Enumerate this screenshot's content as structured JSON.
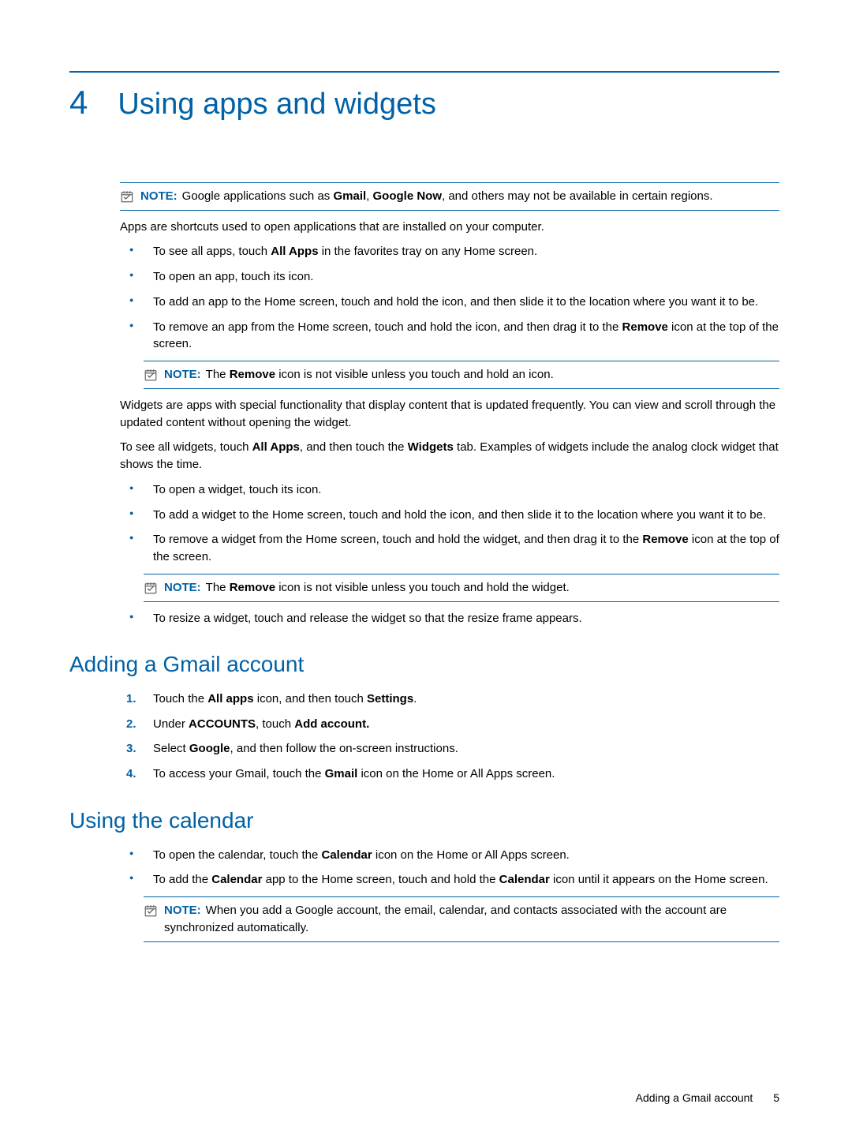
{
  "chapter": {
    "number": "4",
    "title": "Using apps and widgets"
  },
  "notes": {
    "label": "NOTE:",
    "main_region": "Google applications such as <b>Gmail</b>, <b>Google Now</b>, and others may not be available in certain regions.",
    "remove_icon_app": "The <b>Remove</b> icon is not visible unless you touch and hold an icon.",
    "remove_icon_widget": "The <b>Remove</b> icon is not visible unless you touch and hold the widget.",
    "calendar_sync": "When you add a Google account, the email, calendar, and contacts associated with the account are synchronized automatically."
  },
  "paragraphs": {
    "apps_intro": "Apps are shortcuts used to open applications that are installed on your computer.",
    "widgets_intro": "Widgets are apps with special functionality that display content that is updated frequently. You can view and scroll through the updated content without opening the widget.",
    "widgets_see_all": "To see all widgets, touch <b>All Apps</b>, and then touch the <b>Widgets</b> tab. Examples of widgets include the analog clock widget that shows the time."
  },
  "bullets_apps": [
    "To see all apps, touch <b>All Apps</b> in the favorites tray on any Home screen.",
    "To open an app, touch its icon.",
    "To add an app to the Home screen, touch and hold the icon, and then slide it to the location where you want it to be.",
    "To remove an app from the Home screen, touch and hold the icon, and then drag it to the <b>Remove</b> icon at the top of the screen."
  ],
  "bullets_widgets_a": [
    "To open a widget, touch its icon.",
    "To add a widget to the Home screen, touch and hold the icon, and then slide it to the location where you want it to be.",
    "To remove a widget from the Home screen, touch and hold the widget, and then drag it to the <b>Remove</b> icon at the top of the screen."
  ],
  "bullets_widgets_b": [
    "To resize a widget, touch and release the widget so that the resize frame appears."
  ],
  "sections": {
    "gmail": {
      "title": "Adding a Gmail account",
      "steps": [
        "Touch the <b>All apps</b> icon, and then touch <b>Settings</b>.",
        "Under <b>ACCOUNTS</b>, touch <b>Add account.</b>",
        "Select <b>Google</b>, and then follow the on-screen instructions.",
        "To access your Gmail, touch the <b>Gmail</b> icon on the Home or All Apps screen."
      ]
    },
    "calendar": {
      "title": "Using the calendar",
      "bullets": [
        "To open the calendar, touch the <b>Calendar</b> icon on the Home or All Apps screen.",
        "To add the <b>Calendar</b> app to the Home screen, touch and hold the <b>Calendar</b> icon until it appears on the Home screen."
      ]
    }
  },
  "footer": {
    "section": "Adding a Gmail account",
    "page": "5"
  }
}
